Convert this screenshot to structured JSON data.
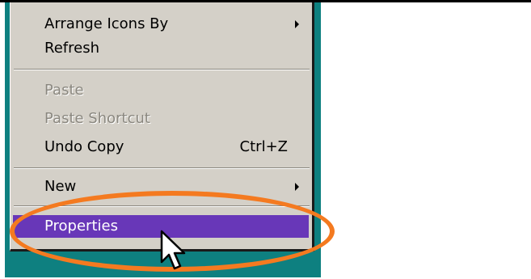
{
  "context_menu": {
    "items": [
      {
        "label": "Arrange Icons By",
        "has_submenu": true
      },
      {
        "label": "Refresh"
      },
      {
        "label": "Paste",
        "disabled": true
      },
      {
        "label": "Paste Shortcut",
        "disabled": true
      },
      {
        "label": "Undo Copy",
        "shortcut": "Ctrl+Z"
      },
      {
        "label": "New",
        "has_submenu": true
      },
      {
        "label": "Properties",
        "highlighted": true
      }
    ]
  },
  "colors": {
    "desktop": "#0e8080",
    "menu_background": "#d4d0c8",
    "highlight": "#6837b8",
    "annotation_ring": "#f47a20"
  },
  "icons": [
    "submenu-arrow-icon",
    "mouse-pointer-icon"
  ]
}
